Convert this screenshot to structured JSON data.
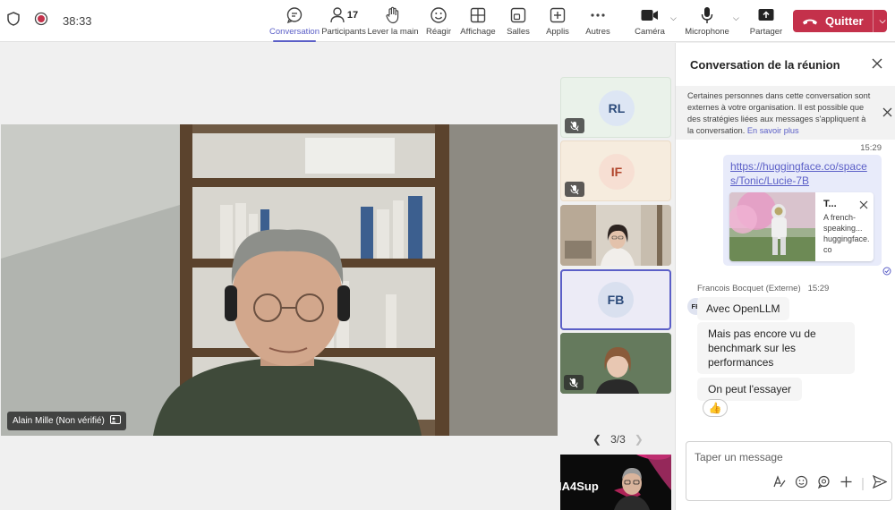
{
  "meeting": {
    "timer": "38:33"
  },
  "toolbar": {
    "conversation": "Conversation",
    "participants": "Participants",
    "participants_count": "17",
    "raise_hand": "Lever la main",
    "react": "Réagir",
    "view": "Affichage",
    "rooms": "Salles",
    "apps": "Applis",
    "more": "Autres",
    "camera": "Caméra",
    "microphone": "Microphone",
    "share": "Partager",
    "leave": "Quitter"
  },
  "stage": {
    "main_speaker": "Alain Mille (Non vérifié)",
    "tiles": [
      {
        "initials": "RL",
        "muted": true,
        "bg": "#eaf2ea",
        "avatar_bg": "#dde6f4",
        "avatar_color": "#2b4a7a"
      },
      {
        "initials": "IF",
        "muted": true,
        "bg": "#f6ecde",
        "avatar_bg": "#f7dfd3",
        "avatar_color": "#b0432a"
      },
      {
        "initials": "",
        "video": "woman-living-room"
      },
      {
        "initials": "FB",
        "muted": false,
        "active": true,
        "bg": "#ecebf6",
        "avatar_bg": "#d9e0ef",
        "avatar_color": "#2b4a7a"
      },
      {
        "initials": "",
        "video": "woman-green-wall",
        "muted": true
      }
    ],
    "pager": "3/3",
    "preview_text": "IA4Sup"
  },
  "chat": {
    "title": "Conversation de la réunion",
    "notice": "Certaines personnes dans cette conversation sont externes à votre organisation. Il est possible que des stratégies liées aux messages s'appliquent à la conversation.",
    "notice_link": "En savoir plus",
    "my_timestamp": "15:29",
    "my_link": "https://huggingface.co/spaces/Tonic/Lucie-7B",
    "card": {
      "title": "T...",
      "desc": "A french-speaking...",
      "source": "huggingface.co"
    },
    "sender": "Francois Bocquet (Externe)",
    "sender_time": "15:29",
    "sender_initials": "FB",
    "messages": [
      "Avec OpenLLM",
      "Mais pas encore vu de benchmark sur les performances",
      "On peut l'essayer"
    ],
    "reaction": "👍",
    "composer_placeholder": "Taper un message"
  },
  "colors": {
    "accent": "#5b5fc7",
    "leave": "#c4314b"
  }
}
